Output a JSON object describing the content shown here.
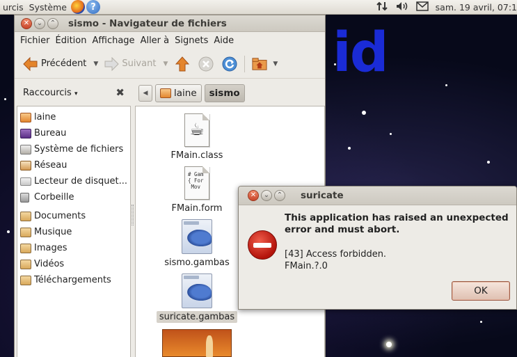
{
  "top_panel": {
    "menu_partial": "urcis",
    "system_menu": "Système",
    "clock": "sam. 19 avril, 07:1"
  },
  "desktop": {
    "bg_text": "id"
  },
  "file_manager": {
    "title": "sismo - Navigateur de fichiers",
    "menus": [
      "Fichier",
      "Édition",
      "Affichage",
      "Aller à",
      "Signets",
      "Aide"
    ],
    "toolbar": {
      "back_label": "Précédent",
      "forward_label": "Suivant"
    },
    "sidebar": {
      "header_label": "Raccourcis",
      "items": [
        {
          "label": "laine",
          "icon": "home-folder-icon"
        },
        {
          "label": "Bureau",
          "icon": "desktop-icon"
        },
        {
          "label": "Système de fichiers",
          "icon": "drive-icon"
        },
        {
          "label": "Réseau",
          "icon": "network-icon"
        },
        {
          "label": "Lecteur de disquet...",
          "icon": "floppy-icon"
        },
        {
          "label": "Corbeille",
          "icon": "trash-icon"
        },
        {
          "label": "Documents",
          "icon": "folder-icon"
        },
        {
          "label": "Musique",
          "icon": "folder-icon"
        },
        {
          "label": "Images",
          "icon": "folder-icon"
        },
        {
          "label": "Vidéos",
          "icon": "folder-icon"
        },
        {
          "label": "Téléchargements",
          "icon": "folder-icon"
        }
      ]
    },
    "pathbar": {
      "parent": "laine",
      "current": "sismo"
    },
    "files": [
      {
        "name": "FMain.class",
        "icon": "java-class-icon"
      },
      {
        "name": "FMain.form",
        "icon": "text-file-icon",
        "preview": "# Gam\n{ For\n Mov"
      },
      {
        "name": "sismo.gambas",
        "icon": "gambas-icon"
      },
      {
        "name": "suricate.gambas",
        "icon": "gambas-icon",
        "selected": true
      },
      {
        "name": "",
        "icon": "image-thumbnail-icon"
      }
    ]
  },
  "dialog": {
    "title": "suricate",
    "heading": "This application has raised an unexpected error and must abort.",
    "message_line1": "[43] Access forbidden.",
    "message_line2": "FMain.?.0",
    "ok_label": "OK"
  },
  "colors": {
    "accent": "#e3872f",
    "error": "#c8201a",
    "bg_text": "#1a2bd6"
  }
}
